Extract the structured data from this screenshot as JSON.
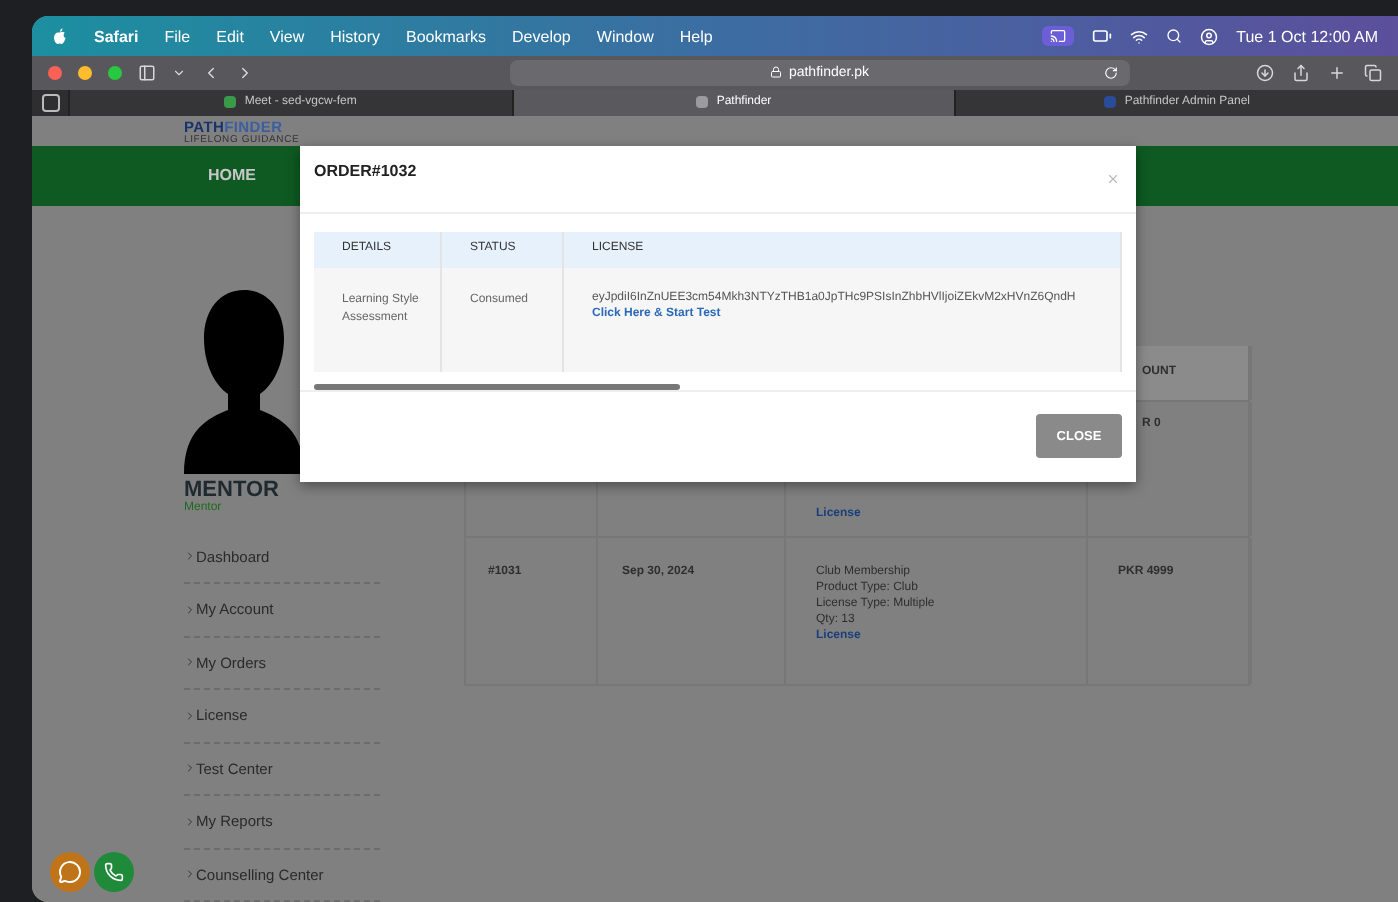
{
  "menu_bar": {
    "items": [
      "Safari",
      "File",
      "Edit",
      "View",
      "History",
      "Bookmarks",
      "Develop",
      "Window",
      "Help"
    ],
    "clock": "Tue 1 Oct  12:00 AM"
  },
  "browser": {
    "url": "pathfinder.pk",
    "tabs": [
      {
        "title": "Meet - sed-vgcw-fem",
        "selected": false
      },
      {
        "title": "Pathfinder",
        "selected": true
      },
      {
        "title": "Pathfinder Admin Panel",
        "selected": false
      }
    ]
  },
  "site": {
    "logo": {
      "name_dark": "PATH",
      "name_light": "FINDER",
      "tagline": "LIFELONG GUIDANCE"
    },
    "nav": [
      "HOME"
    ]
  },
  "profile": {
    "name": "MENTOR",
    "role": "Mentor"
  },
  "sidebar": {
    "items": [
      "Dashboard",
      "My Account",
      "My Orders",
      "License",
      "Test Center",
      "My Reports",
      "Counselling Center"
    ]
  },
  "orders_table": {
    "header_visible": "OUNT",
    "rows": [
      {
        "details": [],
        "link": "License",
        "amount": "R 0"
      },
      {
        "order": "#1031",
        "date": "Sep 30, 2024",
        "details": [
          "Club Membership",
          "Product Type: Club",
          "License Type: Multiple",
          "Qty: 13"
        ],
        "link": "License",
        "amount": "PKR 4999"
      }
    ]
  },
  "modal": {
    "title": "ORDER#1032",
    "columns": [
      "DETAILS",
      "STATUS",
      "LICENSE"
    ],
    "rows": [
      {
        "details": "Learning Style Assessment",
        "status": "Consumed",
        "license": "eyJpdiI6InZnUEE3cm54Mkh3NTYzTHB1a0JpTHc9PSIsInZhbHVlIjoiZEkvM2xHVnZ6QndH",
        "link": "Click Here & Start Test"
      }
    ],
    "button": "CLOSE"
  }
}
